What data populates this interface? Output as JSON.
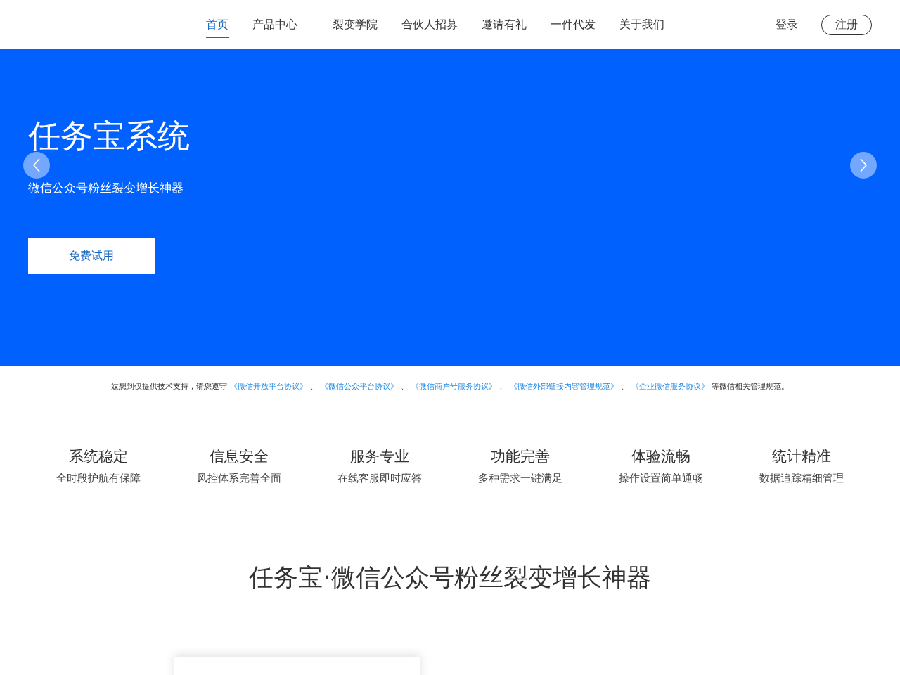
{
  "nav": {
    "items": [
      {
        "label": "首页",
        "selected": true
      },
      {
        "label": "产品中心",
        "selected": false
      },
      {
        "label": "裂变学院",
        "selected": false
      },
      {
        "label": "合伙人招募",
        "selected": false
      },
      {
        "label": "邀请有礼",
        "selected": false
      },
      {
        "label": "一件代发",
        "selected": false
      },
      {
        "label": "关于我们",
        "selected": false
      }
    ],
    "login": "登录",
    "register": "注册"
  },
  "hero": {
    "title": "任务宝系统",
    "subtitle": "微信公众号粉丝裂变增长神器",
    "button": "免费试用"
  },
  "notice": [
    {
      "kind": "text",
      "text": "媒想到仅提供技术支持，请您遵守"
    },
    {
      "kind": "link",
      "text": "《微信开放平台协议》"
    },
    {
      "kind": "text",
      "text": "、"
    },
    {
      "kind": "link",
      "text": "《微信公众平台协议》"
    },
    {
      "kind": "text",
      "text": "、"
    },
    {
      "kind": "link",
      "text": "《微信商户号服务协议》"
    },
    {
      "kind": "text",
      "text": "、"
    },
    {
      "kind": "link",
      "text": "《微信外部链接内容管理规范》"
    },
    {
      "kind": "text",
      "text": "、"
    },
    {
      "kind": "link",
      "text": "《企业微信服务协议》"
    },
    {
      "kind": "text",
      "text": "等微信相关管理规范。"
    }
  ],
  "features": [
    {
      "title": "系统稳定",
      "desc": "全时段护航有保障"
    },
    {
      "title": "信息安全",
      "desc": "风控体系完善全面"
    },
    {
      "title": "服务专业",
      "desc": "在线客服即时应答"
    },
    {
      "title": "功能完善",
      "desc": "多种需求一键满足"
    },
    {
      "title": "体验流畅",
      "desc": "操作设置简单通畅"
    },
    {
      "title": "统计精准",
      "desc": "数据追踪精细管理"
    }
  ],
  "section_title": "任务宝·微信公众号粉丝裂变增长神器"
}
